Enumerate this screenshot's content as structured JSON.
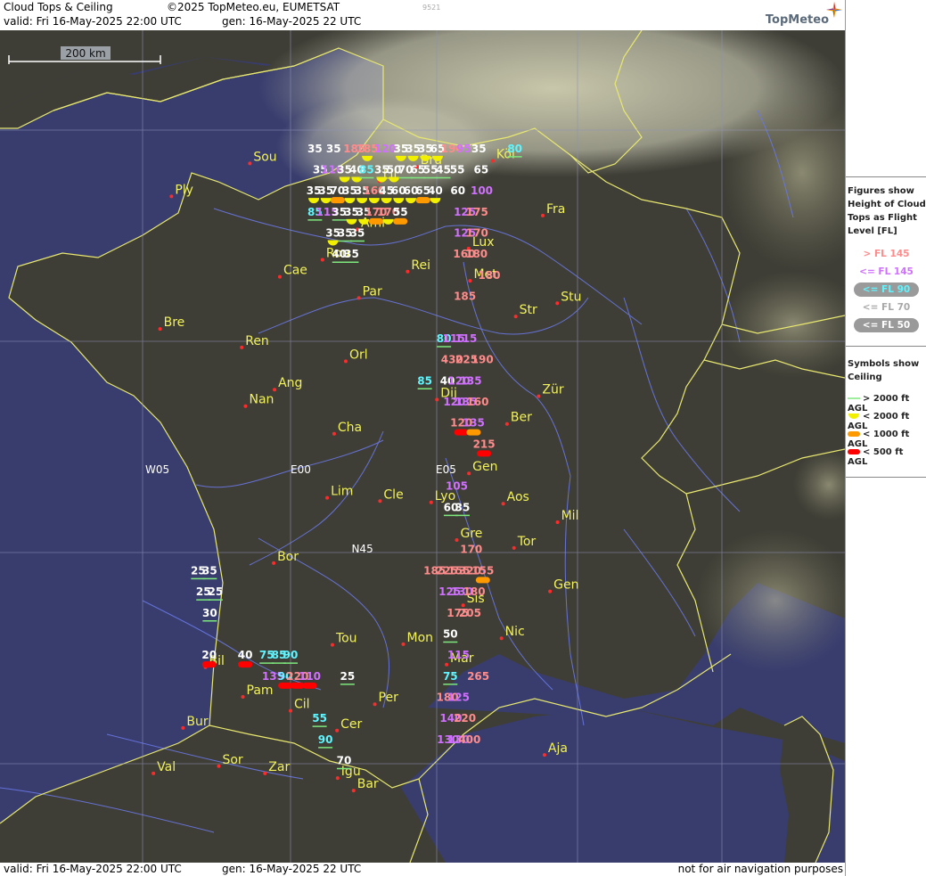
{
  "header": {
    "title": "Cloud Tops & Ceiling",
    "copyright": "©2025 TopMeteo.eu, EUMETSAT",
    "valid": "valid:  Fri  16-May-2025  22:00 UTC",
    "gen": "gen: 16-May-2025 22 UTC",
    "code": "9521",
    "logo": "TopMeteo"
  },
  "footer": {
    "valid": "valid:  Fri  16-May-2025  22:00 UTC",
    "gen": "gen: 16-May-2025 22 UTC",
    "disclaimer": "not for air navigation purposes"
  },
  "scale": {
    "label": "200 km"
  },
  "legend": {
    "figures_title": [
      "Figures show",
      "Height of Cloud",
      "Tops as Flight",
      "Level  [FL]"
    ],
    "figures": [
      {
        "label": "> FL 145",
        "color": "#ff8c8c",
        "pill": false
      },
      {
        "label": "<= FL 145",
        "color": "#d070ff",
        "pill": false
      },
      {
        "label": "<= FL 90",
        "color": "#5ff5ff",
        "pill": true
      },
      {
        "label": "<= FL 70",
        "color": "#a8a8a8",
        "pill": false
      },
      {
        "label": "<= FL 50",
        "color": "#ffffff",
        "pill": true
      }
    ],
    "symbols_title": [
      "Symbols show",
      "Ceiling"
    ],
    "symbols": [
      {
        "label": "> 2000 ft AGL",
        "type": "line",
        "color": "#7de87d"
      },
      {
        "label": "< 2000 ft AGL",
        "type": "half",
        "color": "#f0f000"
      },
      {
        "label": "< 1000 ft AGL",
        "type": "pill",
        "color": "#ff9900"
      },
      {
        "label": "< 500 ft AGL",
        "type": "pill",
        "color": "#ff0000"
      }
    ]
  },
  "grid_labels": [
    {
      "text": "W05",
      "lon": -5,
      "lat": 46.2
    },
    {
      "text": "E00",
      "lon": 0,
      "lat": 46.2
    },
    {
      "text": "E05",
      "lon": 5,
      "lat": 46.2
    },
    {
      "text": "N45",
      "lon": 2.1,
      "lat": 45
    }
  ],
  "cities": [
    {
      "name": "Sou",
      "lon": -1.4,
      "lat": 50.9
    },
    {
      "name": "Ply",
      "lon": -4.1,
      "lat": 50.4
    },
    {
      "name": "Bru",
      "lon": 4.35,
      "lat": 50.85
    },
    {
      "name": "Lil",
      "lon": 3.06,
      "lat": 50.63
    },
    {
      "name": "Köl",
      "lon": 6.96,
      "lat": 50.94
    },
    {
      "name": "Ami",
      "lon": 2.3,
      "lat": 49.9
    },
    {
      "name": "Fra",
      "lon": 8.68,
      "lat": 50.11
    },
    {
      "name": "Lux",
      "lon": 6.13,
      "lat": 49.61
    },
    {
      "name": "Rou",
      "lon": 1.1,
      "lat": 49.44
    },
    {
      "name": "Cae",
      "lon": -0.37,
      "lat": 49.18
    },
    {
      "name": "Rei",
      "lon": 4.03,
      "lat": 49.26
    },
    {
      "name": "Met",
      "lon": 6.18,
      "lat": 49.12
    },
    {
      "name": "Par",
      "lon": 2.35,
      "lat": 48.86
    },
    {
      "name": "Stu",
      "lon": 9.18,
      "lat": 48.78
    },
    {
      "name": "Str",
      "lon": 7.75,
      "lat": 48.58
    },
    {
      "name": "Bre",
      "lon": -4.49,
      "lat": 48.39
    },
    {
      "name": "Ren",
      "lon": -1.68,
      "lat": 48.11
    },
    {
      "name": "Orl",
      "lon": 1.9,
      "lat": 47.9
    },
    {
      "name": "Ang",
      "lon": -0.55,
      "lat": 47.47
    },
    {
      "name": "Nan",
      "lon": -1.55,
      "lat": 47.22
    },
    {
      "name": "Dij",
      "lon": 5.04,
      "lat": 47.32
    },
    {
      "name": "Zür",
      "lon": 8.54,
      "lat": 47.37
    },
    {
      "name": "Ber",
      "lon": 7.45,
      "lat": 46.95
    },
    {
      "name": "Cha",
      "lon": 1.5,
      "lat": 46.8
    },
    {
      "name": "Gen",
      "lon": 6.14,
      "lat": 46.2
    },
    {
      "name": "Lim",
      "lon": 1.26,
      "lat": 45.83
    },
    {
      "name": "Cle",
      "lon": 3.08,
      "lat": 45.78
    },
    {
      "name": "Lyo",
      "lon": 4.84,
      "lat": 45.76
    },
    {
      "name": "Aos",
      "lon": 7.32,
      "lat": 45.74
    },
    {
      "name": "Mil",
      "lon": 9.19,
      "lat": 45.46
    },
    {
      "name": "Tor",
      "lon": 7.69,
      "lat": 45.07
    },
    {
      "name": "Gre",
      "lon": 5.72,
      "lat": 45.19
    },
    {
      "name": "Bor",
      "lon": -0.58,
      "lat": 44.84
    },
    {
      "name": "Sis",
      "lon": 5.94,
      "lat": 44.2
    },
    {
      "name": "Gen",
      "lon": 8.93,
      "lat": 44.41
    },
    {
      "name": "Tou",
      "lon": 1.44,
      "lat": 43.6
    },
    {
      "name": "Mon",
      "lon": 3.88,
      "lat": 43.61
    },
    {
      "name": "Mar",
      "lon": 5.37,
      "lat": 43.3
    },
    {
      "name": "Nic",
      "lon": 7.26,
      "lat": 43.7
    },
    {
      "name": "Bil",
      "lon": -2.93,
      "lat": 43.26
    },
    {
      "name": "Pam",
      "lon": -1.64,
      "lat": 42.81
    },
    {
      "name": "Per",
      "lon": 2.9,
      "lat": 42.7
    },
    {
      "name": "Cil",
      "lon": 0.0,
      "lat": 42.6
    },
    {
      "name": "Cer",
      "lon": 1.6,
      "lat": 42.3
    },
    {
      "name": "Bur",
      "lon": -3.7,
      "lat": 42.34
    },
    {
      "name": "Sor",
      "lon": -2.47,
      "lat": 41.76
    },
    {
      "name": "Aja",
      "lon": 8.74,
      "lat": 41.93
    },
    {
      "name": "Val",
      "lon": -4.72,
      "lat": 41.65
    },
    {
      "name": "Zar",
      "lon": -0.88,
      "lat": 41.65
    },
    {
      "name": "Igu",
      "lon": 1.62,
      "lat": 41.58
    },
    {
      "name": "Bar",
      "lon": 2.17,
      "lat": 41.39
    }
  ],
  "cloud_tops": [
    {
      "v": "35",
      "lon": 0.84,
      "lat": 51.07,
      "c": "w"
    },
    {
      "v": "35",
      "lon": 1.48,
      "lat": 51.07,
      "c": "w"
    },
    {
      "v": "185",
      "lon": 2.2,
      "lat": 51.07,
      "c": "r"
    },
    {
      "v": "185",
      "lon": 2.64,
      "lat": 51.07,
      "c": "r",
      "s": "y"
    },
    {
      "v": "120",
      "lon": 3.26,
      "lat": 51.07,
      "c": "p"
    },
    {
      "v": "35",
      "lon": 3.8,
      "lat": 51.07,
      "c": "w",
      "s": "y"
    },
    {
      "v": "35",
      "lon": 4.22,
      "lat": 51.07,
      "c": "w",
      "s": "y"
    },
    {
      "v": "35",
      "lon": 4.64,
      "lat": 51.07,
      "c": "w",
      "s": "y"
    },
    {
      "v": "65",
      "lon": 5.06,
      "lat": 51.07,
      "c": "w",
      "s": "y"
    },
    {
      "v": "190",
      "lon": 5.56,
      "lat": 51.07,
      "c": "r"
    },
    {
      "v": "95",
      "lon": 5.96,
      "lat": 51.07,
      "c": "p"
    },
    {
      "v": "35",
      "lon": 6.48,
      "lat": 51.07,
      "c": "w"
    },
    {
      "v": "80",
      "lon": 7.72,
      "lat": 51.07,
      "c": "c",
      "s": "g"
    },
    {
      "v": "35",
      "lon": 1.02,
      "lat": 50.75,
      "c": "w"
    },
    {
      "v": "110",
      "lon": 1.44,
      "lat": 50.75,
      "c": "p"
    },
    {
      "v": "35",
      "lon": 1.86,
      "lat": 50.75,
      "c": "w",
      "s": "y"
    },
    {
      "v": "40",
      "lon": 2.28,
      "lat": 50.75,
      "c": "w",
      "s": "y"
    },
    {
      "v": "85",
      "lon": 2.62,
      "lat": 50.75,
      "c": "c",
      "s": "g"
    },
    {
      "v": "35",
      "lon": 3.14,
      "lat": 50.75,
      "c": "w",
      "s": "y"
    },
    {
      "v": "50",
      "lon": 3.56,
      "lat": 50.75,
      "c": "w",
      "s": "y"
    },
    {
      "v": "70",
      "lon": 3.96,
      "lat": 50.75,
      "c": "w",
      "s": "g"
    },
    {
      "v": "65",
      "lon": 4.38,
      "lat": 50.75,
      "c": "w",
      "s": "g"
    },
    {
      "v": "55",
      "lon": 4.82,
      "lat": 50.75,
      "c": "w",
      "s": "g"
    },
    {
      "v": "45",
      "lon": 5.26,
      "lat": 50.75,
      "c": "w",
      "s": "g"
    },
    {
      "v": "55",
      "lon": 5.74,
      "lat": 50.75,
      "c": "w"
    },
    {
      "v": "65",
      "lon": 6.56,
      "lat": 50.75,
      "c": "w"
    },
    {
      "v": "35",
      "lon": 0.8,
      "lat": 50.43,
      "c": "w",
      "s": "y"
    },
    {
      "v": "35",
      "lon": 1.22,
      "lat": 50.43,
      "c": "w",
      "s": "y"
    },
    {
      "v": "70",
      "lon": 1.62,
      "lat": 50.43,
      "c": "w",
      "s": "o"
    },
    {
      "v": "35",
      "lon": 2.04,
      "lat": 50.43,
      "c": "w",
      "s": "y"
    },
    {
      "v": "35",
      "lon": 2.46,
      "lat": 50.43,
      "c": "w",
      "s": "y"
    },
    {
      "v": "160",
      "lon": 2.88,
      "lat": 50.43,
      "c": "r",
      "s": "y"
    },
    {
      "v": "45",
      "lon": 3.3,
      "lat": 50.43,
      "c": "w",
      "s": "y"
    },
    {
      "v": "60",
      "lon": 3.72,
      "lat": 50.43,
      "c": "w",
      "s": "y"
    },
    {
      "v": "60",
      "lon": 4.14,
      "lat": 50.43,
      "c": "w",
      "s": "y"
    },
    {
      "v": "65",
      "lon": 4.56,
      "lat": 50.43,
      "c": "w",
      "s": "o"
    },
    {
      "v": "40",
      "lon": 4.98,
      "lat": 50.43,
      "c": "w",
      "s": "y"
    },
    {
      "v": "60",
      "lon": 5.76,
      "lat": 50.43,
      "c": "w"
    },
    {
      "v": "100",
      "lon": 6.58,
      "lat": 50.43,
      "c": "p"
    },
    {
      "v": "85",
      "lon": 0.84,
      "lat": 50.11,
      "c": "c",
      "s": "g"
    },
    {
      "v": "115",
      "lon": 1.26,
      "lat": 50.11,
      "c": "p"
    },
    {
      "v": "35",
      "lon": 1.68,
      "lat": 50.11,
      "c": "w",
      "s": "g"
    },
    {
      "v": "35",
      "lon": 2.1,
      "lat": 50.11,
      "c": "w",
      "s": "y"
    },
    {
      "v": "35",
      "lon": 2.52,
      "lat": 50.11,
      "c": "w",
      "s": "y"
    },
    {
      "v": "170",
      "lon": 2.94,
      "lat": 50.11,
      "c": "r",
      "s": "o"
    },
    {
      "v": "170",
      "lon": 3.36,
      "lat": 50.11,
      "c": "r",
      "s": "y"
    },
    {
      "v": "55",
      "lon": 3.78,
      "lat": 50.11,
      "c": "w",
      "s": "o"
    },
    {
      "v": "125",
      "lon": 6.0,
      "lat": 50.11,
      "c": "p"
    },
    {
      "v": "175",
      "lon": 6.42,
      "lat": 50.11,
      "c": "r"
    },
    {
      "v": "35",
      "lon": 1.46,
      "lat": 49.79,
      "c": "w",
      "s": "y"
    },
    {
      "v": "35",
      "lon": 1.88,
      "lat": 49.79,
      "c": "w",
      "s": "g"
    },
    {
      "v": "35",
      "lon": 2.3,
      "lat": 49.79,
      "c": "w",
      "s": "g"
    },
    {
      "v": "125",
      "lon": 6.0,
      "lat": 49.79,
      "c": "p"
    },
    {
      "v": "170",
      "lon": 6.42,
      "lat": 49.79,
      "c": "r"
    },
    {
      "v": "40",
      "lon": 1.68,
      "lat": 49.47,
      "c": "w",
      "s": "g"
    },
    {
      "v": "35",
      "lon": 2.1,
      "lat": 49.47,
      "c": "w",
      "s": "g"
    },
    {
      "v": "160",
      "lon": 5.98,
      "lat": 49.47,
      "c": "r"
    },
    {
      "v": "180",
      "lon": 6.4,
      "lat": 49.47,
      "c": "r"
    },
    {
      "v": "180",
      "lon": 6.84,
      "lat": 49.15,
      "c": "r"
    },
    {
      "v": "185",
      "lon": 6.0,
      "lat": 48.83,
      "c": "r"
    },
    {
      "v": "80",
      "lon": 5.28,
      "lat": 48.19,
      "c": "c",
      "s": "g"
    },
    {
      "v": "115",
      "lon": 5.62,
      "lat": 48.19,
      "c": "p"
    },
    {
      "v": "115",
      "lon": 6.04,
      "lat": 48.19,
      "c": "p"
    },
    {
      "v": "430",
      "lon": 5.56,
      "lat": 47.87,
      "c": "r"
    },
    {
      "v": "225",
      "lon": 6.06,
      "lat": 47.87,
      "c": "r"
    },
    {
      "v": "190",
      "lon": 6.6,
      "lat": 47.87,
      "c": "r"
    },
    {
      "v": "85",
      "lon": 4.62,
      "lat": 47.55,
      "c": "c",
      "s": "g"
    },
    {
      "v": "40",
      "lon": 5.4,
      "lat": 47.55,
      "c": "w"
    },
    {
      "v": "120",
      "lon": 5.8,
      "lat": 47.55,
      "c": "p"
    },
    {
      "v": "135",
      "lon": 6.2,
      "lat": 47.55,
      "c": "p"
    },
    {
      "v": "120",
      "lon": 5.64,
      "lat": 47.23,
      "c": "p"
    },
    {
      "v": "135",
      "lon": 6.04,
      "lat": 47.23,
      "c": "p"
    },
    {
      "v": "160",
      "lon": 6.44,
      "lat": 47.23,
      "c": "r"
    },
    {
      "v": "120",
      "lon": 5.88,
      "lat": 46.91,
      "c": "r",
      "s": "red"
    },
    {
      "v": "135",
      "lon": 6.3,
      "lat": 46.91,
      "c": "p",
      "s": "o"
    },
    {
      "v": "215",
      "lon": 6.66,
      "lat": 46.59,
      "c": "r",
      "s": "red"
    },
    {
      "v": "105",
      "lon": 5.72,
      "lat": 45.95,
      "c": "p"
    },
    {
      "v": "60",
      "lon": 5.52,
      "lat": 45.63,
      "c": "w",
      "s": "g"
    },
    {
      "v": "35",
      "lon": 5.92,
      "lat": 45.63,
      "c": "w",
      "s": "g"
    },
    {
      "v": "170",
      "lon": 6.22,
      "lat": 44.99,
      "c": "r"
    },
    {
      "v": "185",
      "lon": 4.96,
      "lat": 44.67,
      "c": "r"
    },
    {
      "v": "225",
      "lon": 5.38,
      "lat": 44.67,
      "c": "r"
    },
    {
      "v": "155",
      "lon": 5.8,
      "lat": 44.67,
      "c": "r"
    },
    {
      "v": "320",
      "lon": 6.18,
      "lat": 44.67,
      "c": "r"
    },
    {
      "v": "155",
      "lon": 6.62,
      "lat": 44.67,
      "c": "r",
      "s": "o"
    },
    {
      "v": "125",
      "lon": 5.48,
      "lat": 44.35,
      "c": "p"
    },
    {
      "v": "130",
      "lon": 5.9,
      "lat": 44.35,
      "c": "p"
    },
    {
      "v": "180",
      "lon": 6.32,
      "lat": 44.35,
      "c": "r"
    },
    {
      "v": "175",
      "lon": 5.76,
      "lat": 44.03,
      "c": "r"
    },
    {
      "v": "205",
      "lon": 6.18,
      "lat": 44.03,
      "c": "r"
    },
    {
      "v": "50",
      "lon": 5.5,
      "lat": 43.71,
      "c": "w",
      "s": "g"
    },
    {
      "v": "115",
      "lon": 5.78,
      "lat": 43.39,
      "c": "p"
    },
    {
      "v": "75",
      "lon": 5.5,
      "lat": 43.07,
      "c": "c",
      "s": "g"
    },
    {
      "v": "265",
      "lon": 6.46,
      "lat": 43.07,
      "c": "r"
    },
    {
      "v": "180",
      "lon": 5.4,
      "lat": 42.75,
      "c": "r"
    },
    {
      "v": "125",
      "lon": 5.78,
      "lat": 42.75,
      "c": "p"
    },
    {
      "v": "140",
      "lon": 5.52,
      "lat": 42.43,
      "c": "p"
    },
    {
      "v": "220",
      "lon": 6.0,
      "lat": 42.43,
      "c": "r"
    },
    {
      "v": "130",
      "lon": 5.42,
      "lat": 42.11,
      "c": "p"
    },
    {
      "v": "130",
      "lon": 5.78,
      "lat": 42.11,
      "c": "p"
    },
    {
      "v": "400",
      "lon": 6.16,
      "lat": 42.11,
      "c": "r"
    },
    {
      "v": "25",
      "lon": -3.18,
      "lat": 44.67,
      "c": "w",
      "s": "g"
    },
    {
      "v": "35",
      "lon": -2.78,
      "lat": 44.67,
      "c": "w",
      "s": "g"
    },
    {
      "v": "25",
      "lon": -3.0,
      "lat": 44.35,
      "c": "w",
      "s": "g"
    },
    {
      "v": "25",
      "lon": -2.58,
      "lat": 44.35,
      "c": "w",
      "s": "g"
    },
    {
      "v": "30",
      "lon": -2.78,
      "lat": 44.03,
      "c": "w",
      "s": "g"
    },
    {
      "v": "20",
      "lon": -2.8,
      "lat": 43.39,
      "c": "w",
      "s": "red"
    },
    {
      "v": "40",
      "lon": -1.56,
      "lat": 43.39,
      "c": "w",
      "s": "red"
    },
    {
      "v": "75",
      "lon": -0.82,
      "lat": 43.39,
      "c": "c",
      "s": "g"
    },
    {
      "v": "85",
      "lon": -0.4,
      "lat": 43.39,
      "c": "c",
      "s": "g"
    },
    {
      "v": "90",
      "lon": 0.0,
      "lat": 43.39,
      "c": "c",
      "s": "g"
    },
    {
      "v": "135",
      "lon": -0.6,
      "lat": 43.07,
      "c": "p"
    },
    {
      "v": "90",
      "lon": -0.18,
      "lat": 43.07,
      "c": "c",
      "s": "red"
    },
    {
      "v": "220",
      "lon": 0.24,
      "lat": 43.07,
      "c": "r",
      "s": "red"
    },
    {
      "v": "110",
      "lon": 0.66,
      "lat": 43.07,
      "c": "p",
      "s": "red"
    },
    {
      "v": "25",
      "lon": 1.96,
      "lat": 43.07,
      "c": "w",
      "s": "g"
    },
    {
      "v": "55",
      "lon": 1.0,
      "lat": 42.43,
      "c": "c",
      "s": "g"
    },
    {
      "v": "90",
      "lon": 1.2,
      "lat": 42.11,
      "c": "c",
      "s": "g"
    },
    {
      "v": "70",
      "lon": 1.84,
      "lat": 41.79,
      "c": "w",
      "s": "g"
    }
  ]
}
